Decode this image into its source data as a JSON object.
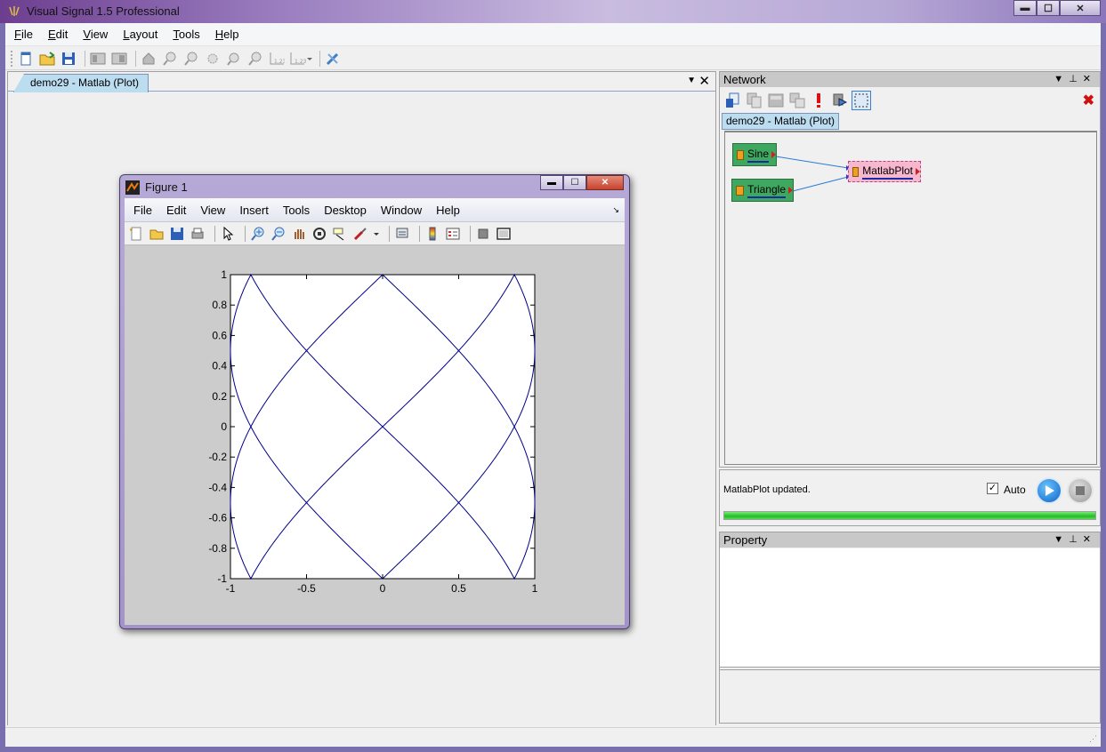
{
  "app": {
    "title": "Visual Signal 1.5 Professional",
    "window_buttons": [
      "minimize",
      "maximize",
      "close"
    ]
  },
  "menu": [
    {
      "label": "File",
      "mnemonic": "F",
      "rest": "ile"
    },
    {
      "label": "Edit",
      "mnemonic": "E",
      "rest": "dit"
    },
    {
      "label": "View",
      "mnemonic": "V",
      "rest": "iew"
    },
    {
      "label": "Layout",
      "mnemonic": "L",
      "rest": "ayout"
    },
    {
      "label": "Tools",
      "mnemonic": "T",
      "rest": "ools"
    },
    {
      "label": "Help",
      "mnemonic": "H",
      "rest": "elp"
    }
  ],
  "toolbar": {
    "icons": [
      "new-file-icon",
      "open-folder-icon",
      "save-icon",
      "layout-icon",
      "layout-alt-icon",
      "home-icon",
      "zoom-in-icon",
      "zoom-out-icon",
      "zoom-fit-icon",
      "zoom-selection-icon",
      "zoom-custom-icon",
      "axis-123-icon",
      "axis-123-dropdown-icon",
      "tools-settings-icon"
    ]
  },
  "document": {
    "tab_label": "demo29 - Matlab (Plot)"
  },
  "figure": {
    "title": "Figure 1",
    "menu": [
      "File",
      "Edit",
      "View",
      "Insert",
      "Tools",
      "Desktop",
      "Window",
      "Help"
    ],
    "toolbar_icons": [
      "new-figure-icon",
      "open-icon",
      "save-icon",
      "print-icon",
      "pointer-icon",
      "zoom-in-icon",
      "zoom-out-icon",
      "pan-icon",
      "rotate-icon",
      "data-cursor-icon",
      "brush-icon",
      "link-icon",
      "colorbar-icon",
      "legend-icon",
      "hide-tools-icon",
      "dock-icon"
    ]
  },
  "chart_data": {
    "type": "line",
    "title": "",
    "xlabel": "",
    "ylabel": "",
    "xlim": [
      -1,
      1
    ],
    "ylim": [
      -1,
      1
    ],
    "xticks": [
      "-1",
      "-0.5",
      "0",
      "0.5",
      "1"
    ],
    "yticks": [
      "1",
      "0.8",
      "0.6",
      "0.4",
      "0.2",
      "0",
      "-0.2",
      "-0.4",
      "-0.6",
      "-0.8",
      "-1"
    ],
    "grid": false,
    "legend": "none",
    "line_color": "#00008b",
    "series": [
      {
        "x_function": "sine",
        "y_function": "triangle",
        "x_frequency": 2,
        "y_frequency": 3,
        "description_values": "x = sin(2t), y = triangle(3t) for t in one period"
      }
    ]
  },
  "network": {
    "header": "Network",
    "tab_label": "demo29 - Matlab (Plot)",
    "toolbar_icons": [
      "add-node-icon",
      "copy-icon",
      "group-icon",
      "ungroup-icon",
      "alert-icon",
      "run-node-icon",
      "select-region-icon"
    ],
    "delete_icon": "delete-x-icon",
    "nodes": [
      {
        "id": "sine",
        "label": "Sine"
      },
      {
        "id": "triangle",
        "label": "Triangle"
      },
      {
        "id": "matlab",
        "label": "MatlabPlot"
      }
    ]
  },
  "status": {
    "message": "MatlabPlot updated.",
    "auto_label": "Auto",
    "auto_checked": true,
    "progress_percent": 100
  },
  "property": {
    "header": "Property"
  },
  "colors": {
    "accent": "#bcdcf0",
    "node_green": "#3fa860",
    "node_pink": "#f7b8cf",
    "progress_green": "#1fbf1f"
  }
}
